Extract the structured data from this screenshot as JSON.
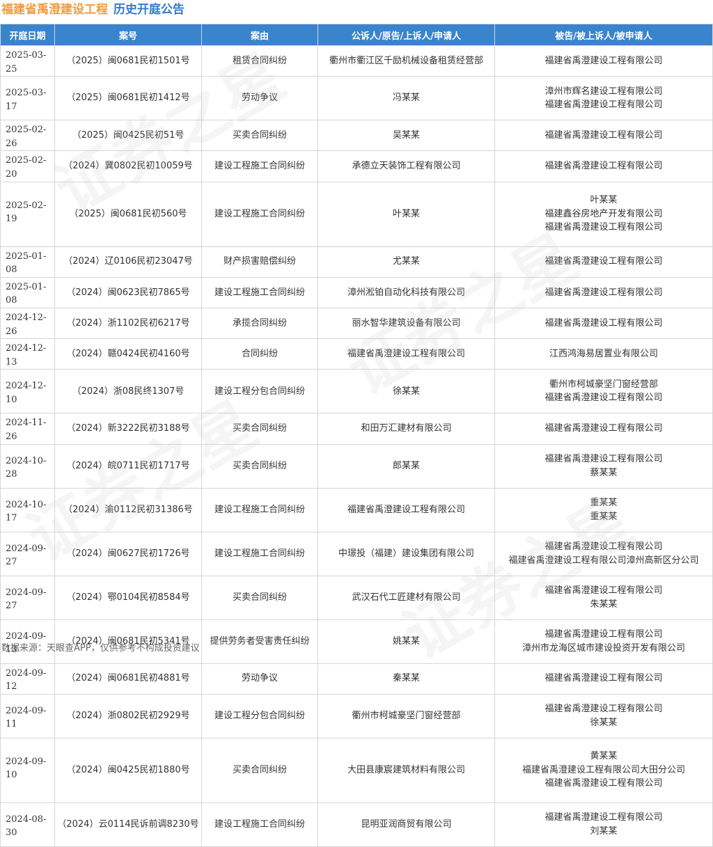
{
  "header": {
    "company": "福建省禹澄建设工程",
    "title": "历史开庭公告"
  },
  "columns": [
    "开庭日期",
    "案号",
    "案由",
    "公诉人/原告/上诉人/申请人",
    "被告/被上诉人/被申请人"
  ],
  "rows": [
    {
      "date": "2025-03-25",
      "case_no": "（2025）闽0681民初1501号",
      "cause": "租赁合同纠纷",
      "plaintiffs": [
        "衢州市衢江区千励机械设备租赁经营部"
      ],
      "defendants": [
        "福建省禹澄建设工程有限公司"
      ]
    },
    {
      "date": "2025-03-17",
      "case_no": "（2025）闽0681民初1412号",
      "cause": "劳动争议",
      "plaintiffs": [
        "冯某某"
      ],
      "defendants": [
        "漳州市辉名建设工程有限公司",
        "福建省禹澄建设工程有限公司"
      ]
    },
    {
      "date": "2025-02-26",
      "case_no": "（2025）闽0425民初51号",
      "cause": "买卖合同纠纷",
      "plaintiffs": [
        "吴某某"
      ],
      "defendants": [
        "福建省禹澄建设工程有限公司"
      ]
    },
    {
      "date": "2025-02-20",
      "case_no": "（2024）冀0802民初10059号",
      "cause": "建设工程施工合同纠纷",
      "plaintiffs": [
        "承德立天装饰工程有限公司"
      ],
      "defendants": [
        "福建省禹澄建设工程有限公司"
      ]
    },
    {
      "date": "2025-02-19",
      "case_no": "（2025）闽0681民初560号",
      "cause": "建设工程施工合同纠纷",
      "plaintiffs": [
        "叶某某"
      ],
      "defendants": [
        "叶某某",
        "福建鑫谷房地产开发有限公司",
        "福建省禹澄建设工程有限公司"
      ]
    },
    {
      "date": "2025-01-08",
      "case_no": "（2024）辽0106民初23047号",
      "cause": "财产损害赔偿纠纷",
      "plaintiffs": [
        "尤某某"
      ],
      "defendants": [
        "福建省禹澄建设工程有限公司"
      ]
    },
    {
      "date": "2025-01-08",
      "case_no": "（2024）闽0623民初7865号",
      "cause": "建设工程施工合同纠纷",
      "plaintiffs": [
        "漳州淞铂自动化科技有限公司"
      ],
      "defendants": [
        "福建省禹澄建设工程有限公司"
      ]
    },
    {
      "date": "2024-12-26",
      "case_no": "（2024）浙1102民初6217号",
      "cause": "承揽合同纠纷",
      "plaintiffs": [
        "丽水智华建筑设备有限公司"
      ],
      "defendants": [
        "福建省禹澄建设工程有限公司"
      ]
    },
    {
      "date": "2024-12-13",
      "case_no": "（2024）赣0424民初4160号",
      "cause": "合同纠纷",
      "plaintiffs": [
        "福建省禹澄建设工程有限公司"
      ],
      "defendants": [
        "江西鸿海易居置业有限公司"
      ]
    },
    {
      "date": "2024-12-10",
      "case_no": "（2024）浙08民终1307号",
      "cause": "建设工程分包合同纠纷",
      "plaintiffs": [
        "徐某某"
      ],
      "defendants": [
        "衢州市柯城豪坚门窗经营部",
        "福建省禹澄建设工程有限公司"
      ]
    },
    {
      "date": "2024-11-26",
      "case_no": "（2024）新3222民初3188号",
      "cause": "买卖合同纠纷",
      "plaintiffs": [
        "和田万汇建材有限公司"
      ],
      "defendants": [
        "福建省禹澄建设工程有限公司"
      ]
    },
    {
      "date": "2024-10-28",
      "case_no": "（2024）皖0711民初1717号",
      "cause": "买卖合同纠纷",
      "plaintiffs": [
        "郎某某"
      ],
      "defendants": [
        "福建省禹澄建设工程有限公司",
        "蔡某某"
      ]
    },
    {
      "date": "2024-10-17",
      "case_no": "（2024）渝0112民初31386号",
      "cause": "建设工程施工合同纠纷",
      "plaintiffs": [
        "福建省禹澄建设工程有限公司"
      ],
      "defendants": [
        "重某某",
        "重某某"
      ]
    },
    {
      "date": "2024-09-27",
      "case_no": "（2024）闽0627民初1726号",
      "cause": "建设工程施工合同纠纷",
      "plaintiffs": [
        "中璟投（福建）建设集团有限公司"
      ],
      "defendants": [
        "福建省禹澄建设工程有限公司",
        "福建省禹澄建设工程有限公司漳州高新区分公司"
      ]
    },
    {
      "date": "2024-09-27",
      "case_no": "（2024）鄂0104民初8584号",
      "cause": "买卖合同纠纷",
      "plaintiffs": [
        "武汉石代工匠建材有限公司"
      ],
      "defendants": [
        "福建省禹澄建设工程有限公司",
        "朱某某"
      ]
    },
    {
      "date": "2024-09-13",
      "case_no": "（2024）闽0681民初5341号",
      "cause": "提供劳务者受害责任纠纷",
      "plaintiffs": [
        "姚某某"
      ],
      "defendants": [
        "福建省禹澄建设工程有限公司",
        "漳州市龙海区城市建设投资开发有限公司"
      ]
    },
    {
      "date": "2024-09-12",
      "case_no": "（2024）闽0681民初4881号",
      "cause": "劳动争议",
      "plaintiffs": [
        "秦某某"
      ],
      "defendants": [
        "福建省禹澄建设工程有限公司"
      ]
    },
    {
      "date": "2024-09-11",
      "case_no": "（2024）浙0802民初2929号",
      "cause": "建设工程分包合同纠纷",
      "plaintiffs": [
        "衢州市柯城豪坚门窗经营部"
      ],
      "defendants": [
        "福建省禹澄建设工程有限公司",
        "徐某某"
      ]
    },
    {
      "date": "2024-09-10",
      "case_no": "（2024）闽0425民初1880号",
      "cause": "买卖合同纠纷",
      "plaintiffs": [
        "大田县康宸建筑材料有限公司"
      ],
      "defendants": [
        "黄某某",
        "福建省禹澄建设工程有限公司大田分公司",
        "福建省禹澄建设工程有限公司"
      ]
    },
    {
      "date": "2024-08-30",
      "case_no": "（2024）云0114民诉前调8230号",
      "cause": "建设工程施工合同纠纷",
      "plaintiffs": [
        "昆明亚润商贸有限公司"
      ],
      "defendants": [
        "福建省禹澄建设工程有限公司",
        "刘某某"
      ]
    }
  ],
  "footer": "数据来源：天眼查APP，仅供参考不构成投资建议",
  "watermark": "证券之星"
}
